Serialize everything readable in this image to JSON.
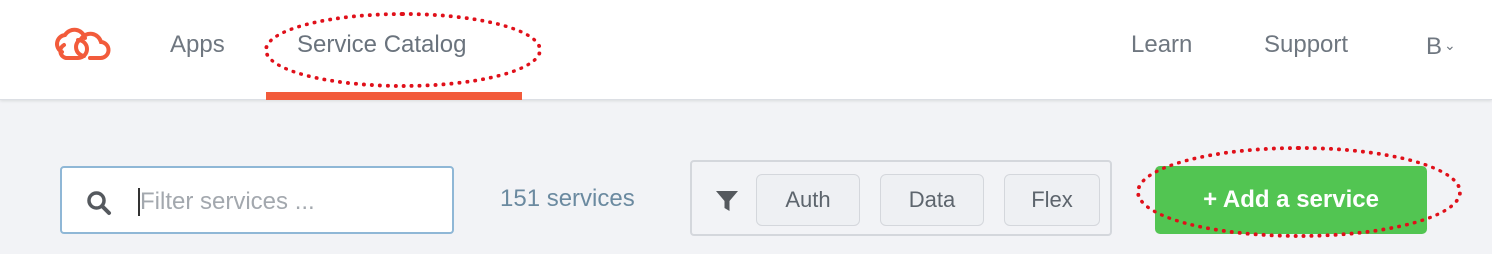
{
  "header": {
    "logo_icon": "linked-clouds-logo-icon",
    "nav": {
      "apps": "Apps",
      "service_catalog": "Service Catalog",
      "learn": "Learn",
      "support": "Support",
      "user": "B"
    },
    "active_tab": "service_catalog",
    "accent_color": "#f25b3b"
  },
  "toolbar": {
    "search": {
      "placeholder": "Filter services ...",
      "value": "",
      "icon": "search-icon"
    },
    "service_count": "151 services",
    "filter": {
      "icon": "funnel-icon",
      "chips": [
        "Auth",
        "Data",
        "Flex"
      ]
    },
    "add_button": "+ Add a service",
    "add_button_color": "#52c552"
  },
  "annotations": {
    "color": "#e0101a",
    "style": "red dotted ellipse",
    "targets": [
      "Service Catalog",
      "+ Add a service"
    ]
  }
}
